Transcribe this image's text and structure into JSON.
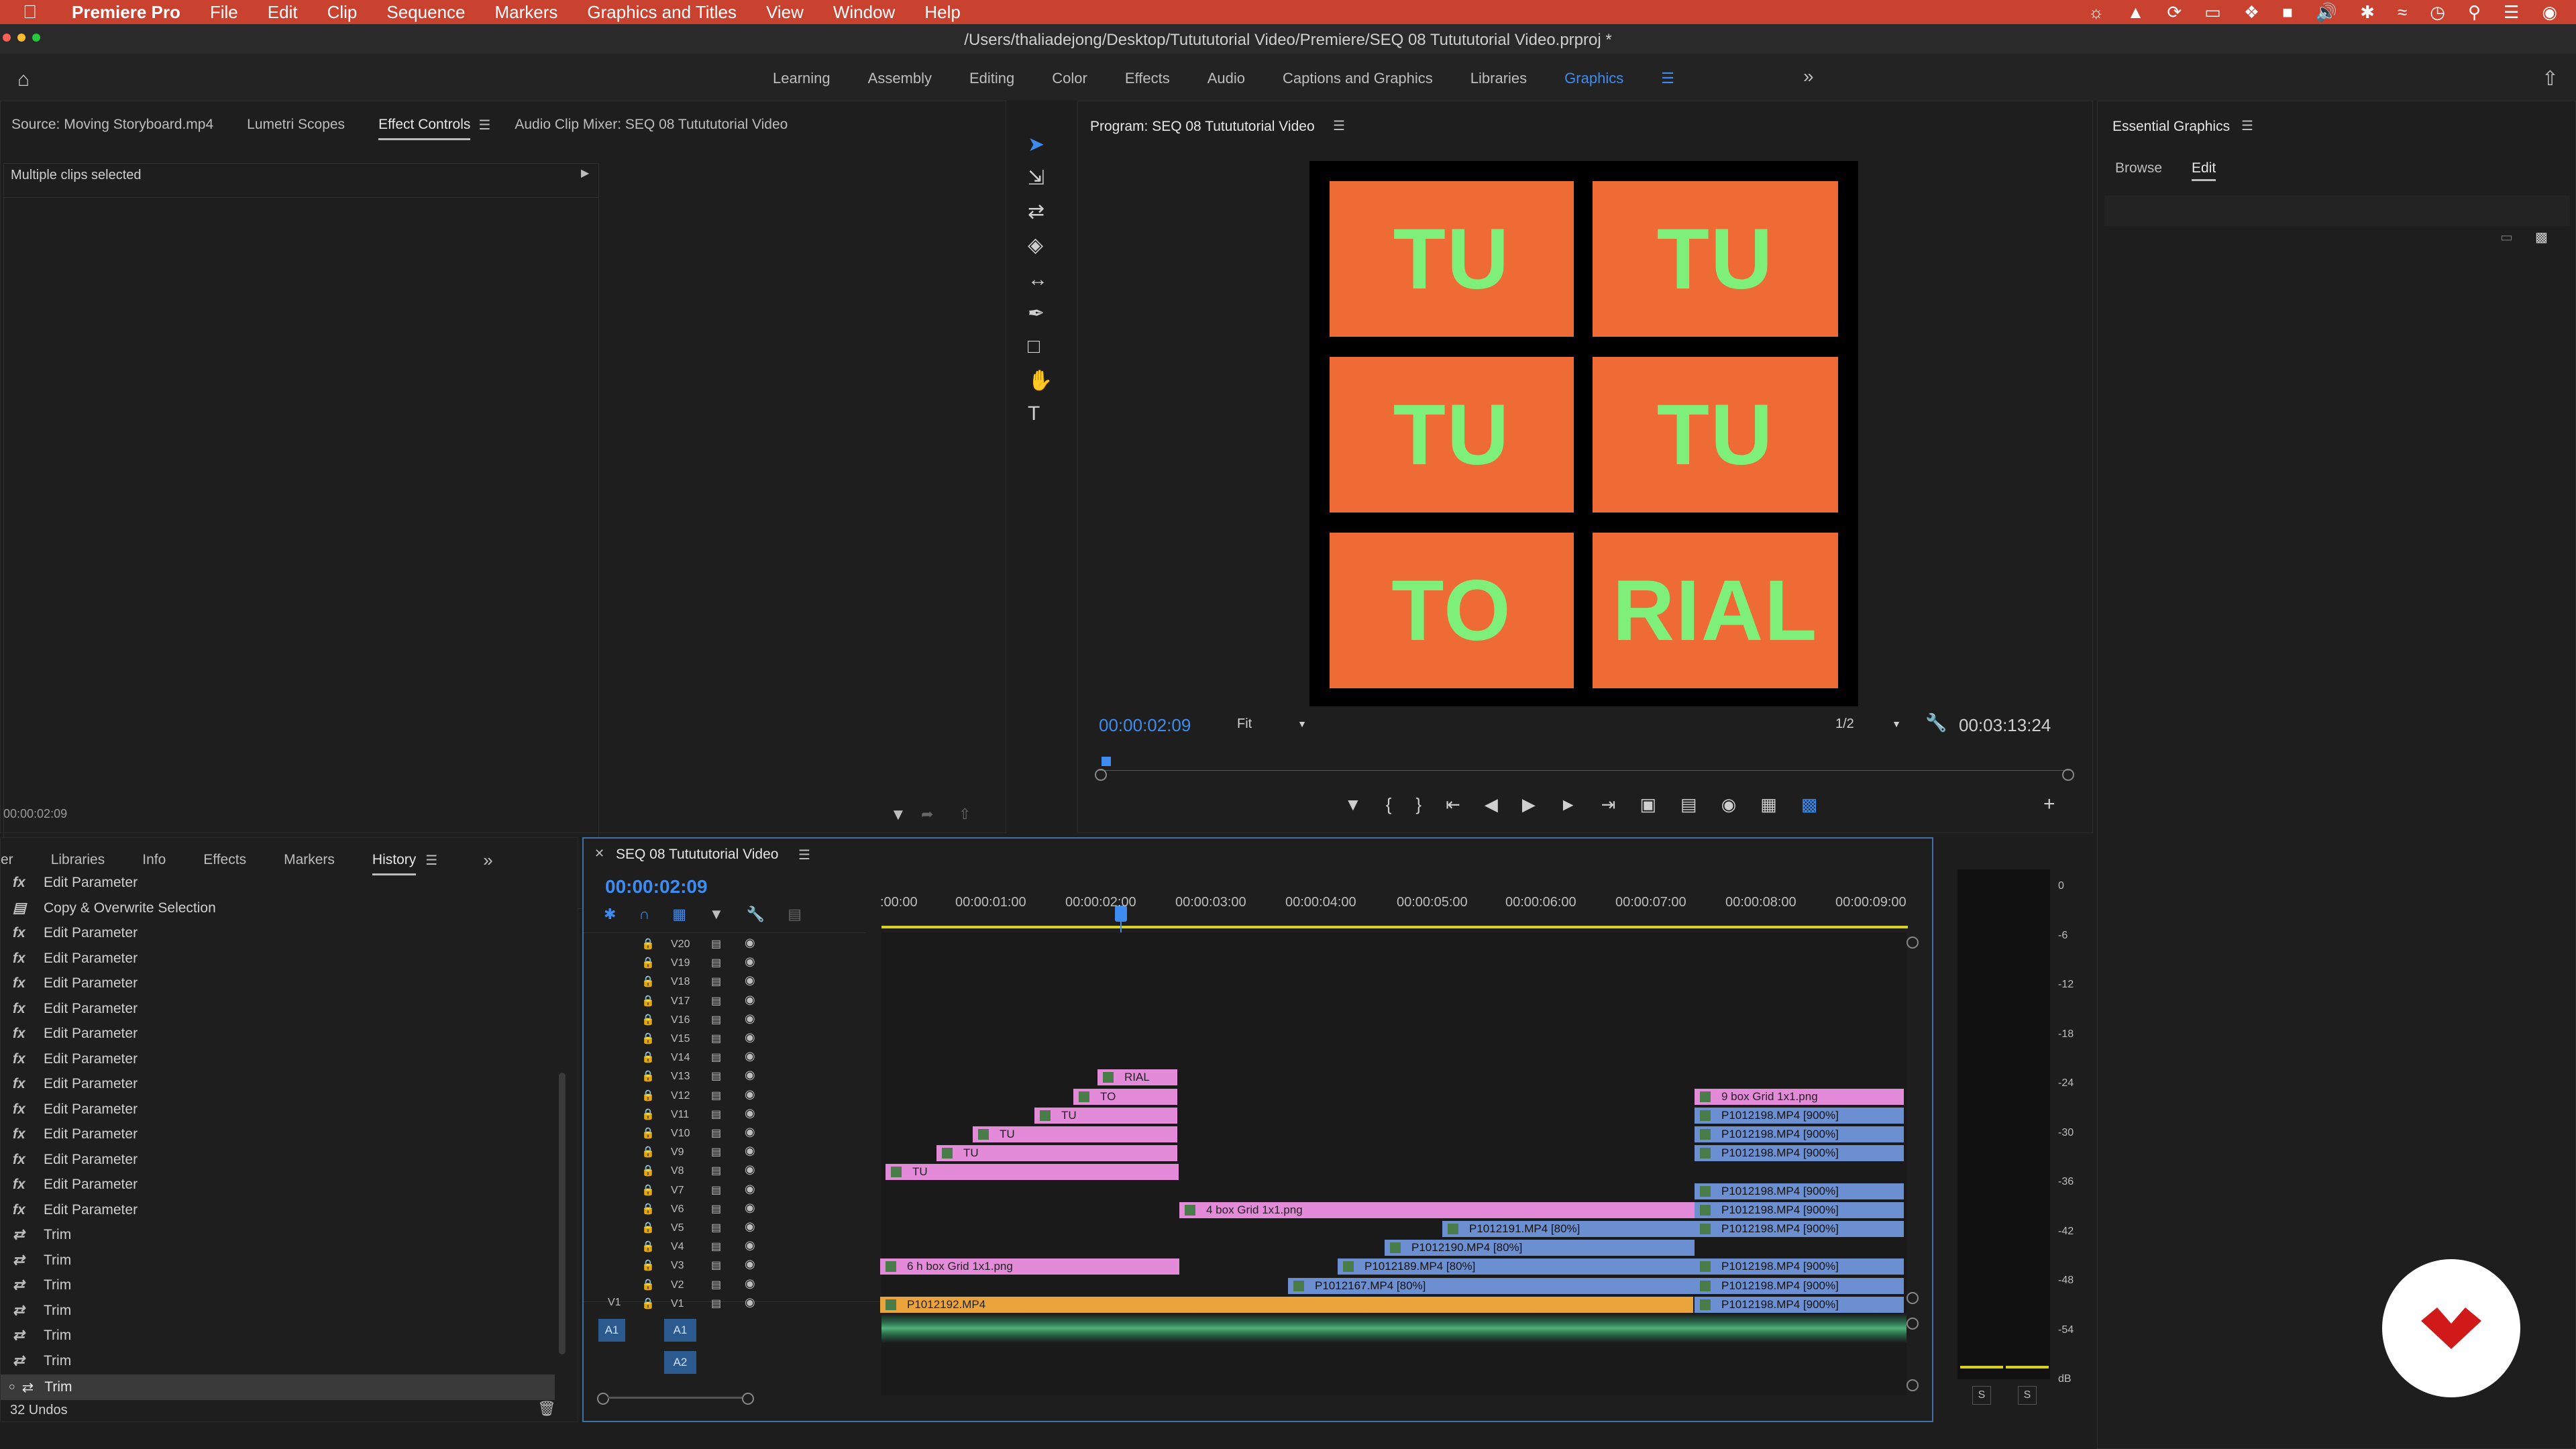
{
  "menubar": {
    "app": "Premiere Pro",
    "items": [
      "File",
      "Edit",
      "Clip",
      "Sequence",
      "Markers",
      "Graphics and Titles",
      "View",
      "Window",
      "Help"
    ]
  },
  "window": {
    "title": "/Users/thaliadejong/Desktop/Tutututorial Video/Premiere/SEQ 08 Tutututorial Video.prproj *"
  },
  "workspaces": {
    "tabs": [
      "Learning",
      "Assembly",
      "Editing",
      "Color",
      "Effects",
      "Audio",
      "Captions and Graphics",
      "Libraries",
      "Graphics"
    ],
    "active": "Graphics"
  },
  "source_panel": {
    "tabs": [
      "Source: Moving Storyboard.mp4",
      "Lumetri Scopes",
      "Effect Controls",
      "Audio Clip Mixer: SEQ 08 Tutututorial Video"
    ],
    "active_tab": "Effect Controls",
    "message": "Multiple clips selected",
    "timecode": "00:00:02:09"
  },
  "program": {
    "title": "Program: SEQ 08 Tutututorial Video",
    "cells": [
      "TU",
      "TU",
      "TU",
      "TU",
      "TO",
      "RIAL"
    ],
    "timecode": "00:00:02:09",
    "fit": "Fit",
    "resolution": "1/2",
    "duration": "00:03:13:24"
  },
  "essential_graphics": {
    "title": "Essential Graphics",
    "tabs": [
      "Browse",
      "Edit"
    ],
    "active_tab": "Edit"
  },
  "bottom_left": {
    "tabs": [
      "er",
      "Libraries",
      "Info",
      "Effects",
      "Markers",
      "History"
    ],
    "active_tab": "History",
    "history": [
      {
        "icon": "fx",
        "label": "Edit Parameter"
      },
      {
        "icon": "doc",
        "label": "Copy & Overwrite Selection"
      },
      {
        "icon": "fx",
        "label": "Edit Parameter"
      },
      {
        "icon": "fx",
        "label": "Edit Parameter"
      },
      {
        "icon": "fx",
        "label": "Edit Parameter"
      },
      {
        "icon": "fx",
        "label": "Edit Parameter"
      },
      {
        "icon": "fx",
        "label": "Edit Parameter"
      },
      {
        "icon": "fx",
        "label": "Edit Parameter"
      },
      {
        "icon": "fx",
        "label": "Edit Parameter"
      },
      {
        "icon": "fx",
        "label": "Edit Parameter"
      },
      {
        "icon": "fx",
        "label": "Edit Parameter"
      },
      {
        "icon": "fx",
        "label": "Edit Parameter"
      },
      {
        "icon": "fx",
        "label": "Edit Parameter"
      },
      {
        "icon": "fx",
        "label": "Edit Parameter"
      },
      {
        "icon": "trim",
        "label": "Trim"
      },
      {
        "icon": "trim",
        "label": "Trim"
      },
      {
        "icon": "trim",
        "label": "Trim"
      },
      {
        "icon": "trim",
        "label": "Trim"
      },
      {
        "icon": "trim",
        "label": "Trim"
      },
      {
        "icon": "trim",
        "label": "Trim"
      },
      {
        "icon": "trim",
        "label": "Trim"
      }
    ],
    "undos": "32 Undos"
  },
  "timeline": {
    "title": "SEQ 08 Tutututorial Video",
    "timecode": "00:00:02:09",
    "ruler": [
      ":00:00",
      "00:00:01:00",
      "00:00:02:00",
      "00:00:03:00",
      "00:00:04:00",
      "00:00:05:00",
      "00:00:06:00",
      "00:00:07:00",
      "00:00:08:00",
      "00:00:09:00"
    ],
    "video_tracks": [
      "V20",
      "V19",
      "V18",
      "V17",
      "V16",
      "V15",
      "V14",
      "V13",
      "V12",
      "V11",
      "V10",
      "V9",
      "V8",
      "V7",
      "V6",
      "V5",
      "V4",
      "V3",
      "V2",
      "V1"
    ],
    "audio_tracks": [
      "A1",
      "A2"
    ],
    "clips": [
      {
        "track": "V13",
        "label": "RIAL",
        "color": "pink"
      },
      {
        "track": "V12",
        "label": "TO",
        "color": "pink"
      },
      {
        "track": "V11",
        "label": "TU",
        "color": "pink"
      },
      {
        "track": "V10",
        "label": "TU",
        "color": "pink"
      },
      {
        "track": "V9",
        "label": "TU",
        "color": "pink"
      },
      {
        "track": "V8",
        "label": "TU",
        "color": "pink"
      },
      {
        "track": "V6",
        "label": "4 box Grid 1x1.png",
        "color": "pink"
      },
      {
        "track": "V5",
        "label": "P1012191.MP4 [80%]",
        "color": "blue"
      },
      {
        "track": "V4",
        "label": "P1012190.MP4 [80%]",
        "color": "blue"
      },
      {
        "track": "V3",
        "label": "6 h box Grid 1x1.png",
        "color": "pink"
      },
      {
        "track": "V3",
        "label": "P1012189.MP4 [80%]",
        "color": "blue"
      },
      {
        "track": "V2",
        "label": "P1012167.MP4 [80%]",
        "color": "blue"
      },
      {
        "track": "V1",
        "label": "P1012192.MP4",
        "color": "orange"
      },
      {
        "track": "V12",
        "label": "9 box Grid 1x1.png",
        "color": "pink"
      },
      {
        "track": "V11",
        "label": "P1012198.MP4 [900%]",
        "color": "blue"
      },
      {
        "track": "V10",
        "label": "P1012198.MP4 [900%]",
        "color": "blue"
      },
      {
        "track": "V9",
        "label": "P1012198.MP4 [900%]",
        "color": "blue"
      },
      {
        "track": "V7",
        "label": "P1012198.MP4 [900%]",
        "color": "blue"
      },
      {
        "track": "V6",
        "label": "P1012198.MP4 [900%]",
        "color": "blue"
      },
      {
        "track": "V5",
        "label": "P1012198.MP4 [900%]",
        "color": "blue"
      },
      {
        "track": "V3",
        "label": "P1012198.MP4 [900%]",
        "color": "blue"
      },
      {
        "track": "V2",
        "label": "P1012198.MP4 [900%]",
        "color": "blue"
      },
      {
        "track": "V1",
        "label": "P1012198.MP4 [900%]",
        "color": "blue"
      }
    ]
  },
  "meter": {
    "db": [
      "0",
      "-6",
      "-12",
      "-18",
      "-24",
      "-30",
      "-36",
      "-42",
      "-48",
      "-54",
      "dB"
    ],
    "solo": [
      "S",
      "S"
    ]
  },
  "colors": {
    "accent": "#3d8cf2",
    "menubar": "#c9412f",
    "cell": "#ee6b35",
    "cell_text": "#7ef07a"
  }
}
